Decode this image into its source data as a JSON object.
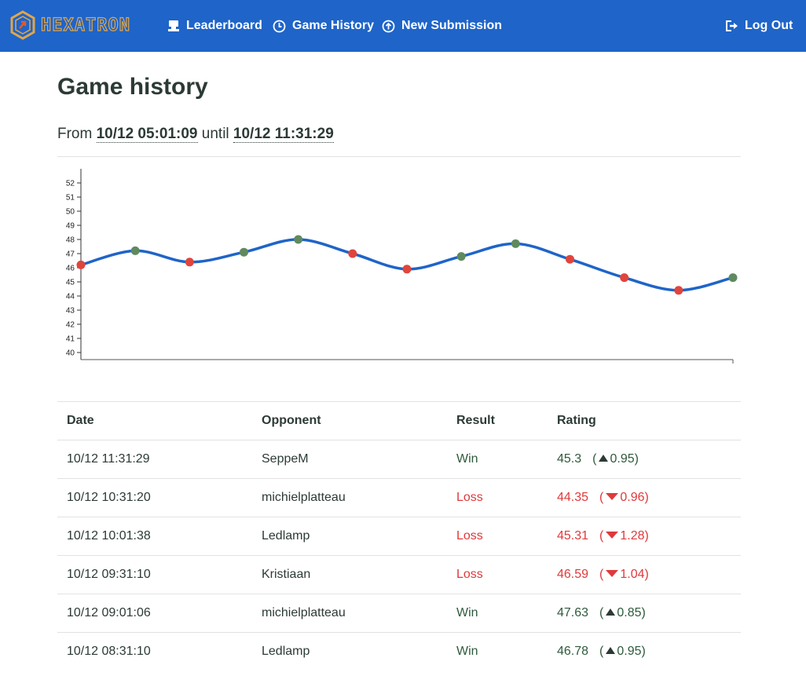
{
  "nav": {
    "brand": "HEXATRON",
    "items": [
      {
        "label": "Leaderboard",
        "icon": "trophy-podium-icon"
      },
      {
        "label": "Game History",
        "icon": "clock-icon"
      },
      {
        "label": "New Submission",
        "icon": "upload-icon"
      }
    ],
    "logout": "Log Out"
  },
  "page": {
    "title": "Game history",
    "from_word": "From",
    "from": "10/12 05:01:09",
    "until_word": "until",
    "until": "10/12 11:31:29"
  },
  "colors": {
    "navbar": "#1f64c8",
    "win": "#2e5a3c",
    "loss": "#e0393b",
    "line": "#1f64c8",
    "win_dot": "#5f8a5f",
    "loss_dot": "#e0453c"
  },
  "chart_data": {
    "type": "line",
    "ylim": [
      39.5,
      53
    ],
    "y_ticks": [
      40,
      41,
      42,
      43,
      44,
      45,
      46,
      47,
      48,
      49,
      50,
      51,
      52
    ],
    "series": [
      {
        "values": [
          46.2,
          47.2,
          46.4,
          47.1,
          48.0,
          47.0,
          45.9,
          46.8,
          47.7,
          46.6,
          45.3,
          44.4,
          45.3
        ],
        "results": [
          "loss",
          "win",
          "loss",
          "win",
          "win",
          "loss",
          "loss",
          "win",
          "win",
          "loss",
          "loss",
          "loss",
          "win"
        ]
      }
    ]
  },
  "table": {
    "headers": [
      "Date",
      "Opponent",
      "Result",
      "Rating"
    ],
    "rows": [
      {
        "date": "10/12 11:31:29",
        "opponent": "SeppeM",
        "result": "Win",
        "rating": "45.3",
        "delta": "0.95",
        "dir": "up"
      },
      {
        "date": "10/12 10:31:20",
        "opponent": "michielplatteau",
        "result": "Loss",
        "rating": "44.35",
        "delta": "0.96",
        "dir": "down"
      },
      {
        "date": "10/12 10:01:38",
        "opponent": "Ledlamp",
        "result": "Loss",
        "rating": "45.31",
        "delta": "1.28",
        "dir": "down"
      },
      {
        "date": "10/12 09:31:10",
        "opponent": "Kristiaan",
        "result": "Loss",
        "rating": "46.59",
        "delta": "1.04",
        "dir": "down"
      },
      {
        "date": "10/12 09:01:06",
        "opponent": "michielplatteau",
        "result": "Win",
        "rating": "47.63",
        "delta": "0.85",
        "dir": "up"
      },
      {
        "date": "10/12 08:31:10",
        "opponent": "Ledlamp",
        "result": "Win",
        "rating": "46.78",
        "delta": "0.95",
        "dir": "up"
      }
    ]
  }
}
